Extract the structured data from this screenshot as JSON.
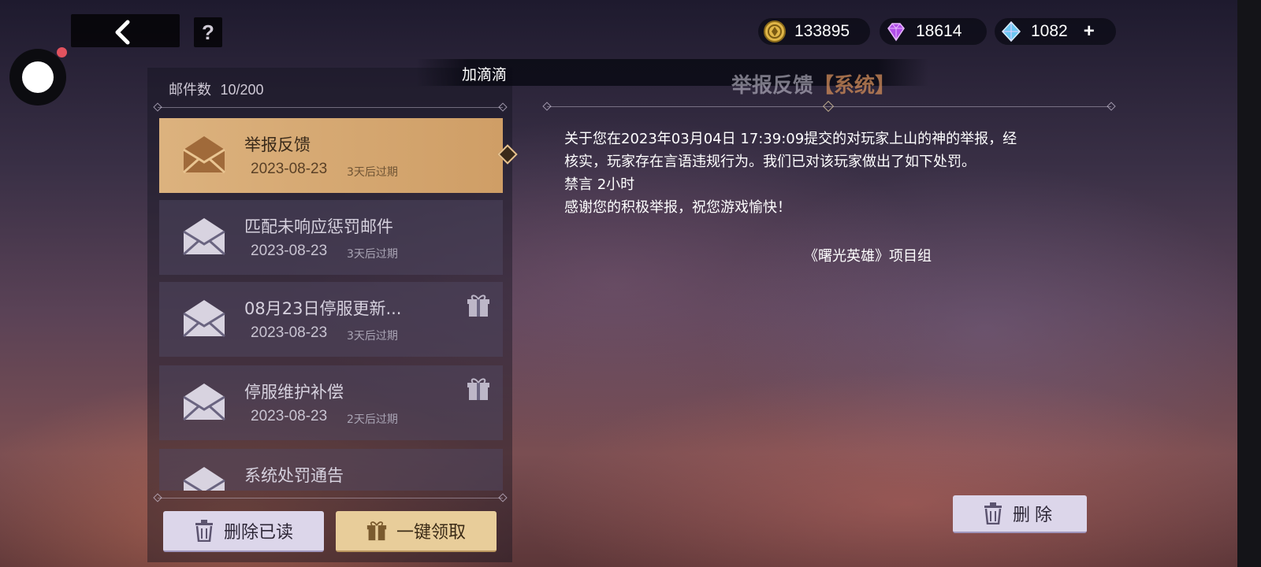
{
  "topbar": {
    "back_icon": "chevron-left-icon",
    "help_label": "?",
    "currencies": [
      {
        "name": "gold-coin",
        "icon": "gold-coin-icon",
        "value": "133895"
      },
      {
        "name": "purple-gem",
        "icon": "purple-diamond-icon",
        "value": "18614"
      },
      {
        "name": "blue-crystal",
        "icon": "blue-crystal-icon",
        "value": "1082"
      }
    ],
    "plus_label": "+"
  },
  "notification_banner": "加滴滴",
  "mail_list": {
    "count_label": "邮件数",
    "count_value": "10/200",
    "items": [
      {
        "title": "举报反馈",
        "date": "2023-08-23",
        "expire": "3天后过期",
        "active": true,
        "gift": false
      },
      {
        "title": "匹配未响应惩罚邮件",
        "date": "2023-08-23",
        "expire": "3天后过期",
        "active": false,
        "gift": false
      },
      {
        "title": "08月23日停服更新...",
        "date": "2023-08-23",
        "expire": "3天后过期",
        "active": false,
        "gift": true
      },
      {
        "title": "停服维护补偿",
        "date": "2023-08-23",
        "expire": "2天后过期",
        "active": false,
        "gift": true
      },
      {
        "title": "系统处罚通告",
        "date": "",
        "expire": "",
        "active": false,
        "gift": false
      }
    ],
    "delete_read_label": "删除已读",
    "claim_all_label": "一键领取"
  },
  "detail": {
    "title": "举报反馈",
    "tag": "【系统】",
    "body_lines": [
      "关于您在2023年03月04日 17:39:09提交的对玩家上山的神的举报，经",
      "核实，玩家存在言语违规行为。我们已对该玩家做出了如下处罚。",
      "禁言 2小时",
      "感谢您的积极举报，祝您游戏愉快！"
    ],
    "signature": "《曙光英雄》项目组",
    "delete_label": "删除"
  },
  "colors": {
    "active_item": "#d9ad78",
    "accent_tag": "#d28c5a",
    "button_lavender": "#dcd6ea",
    "button_gold": "#e8cd9a"
  }
}
